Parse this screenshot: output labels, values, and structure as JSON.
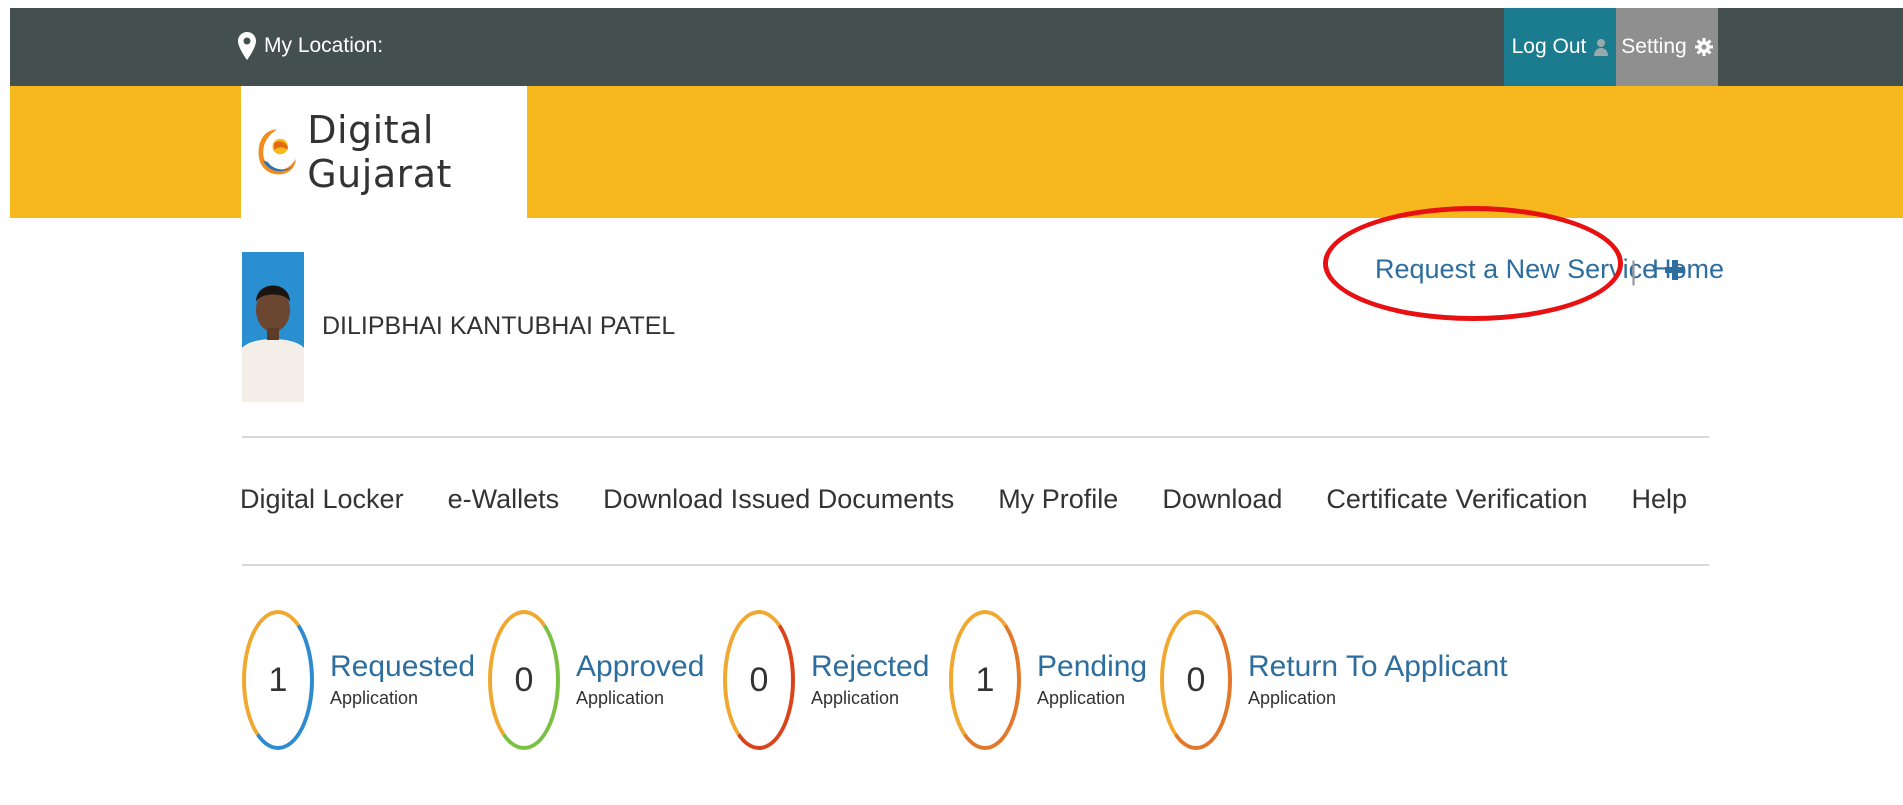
{
  "topbar": {
    "location_label": "My Location:",
    "logout_label": "Log Out",
    "setting_label": "Setting"
  },
  "brand": {
    "name": "Digital Gujarat"
  },
  "user": {
    "name": "DILIPBHAI KANTUBHAI PATEL"
  },
  "actions": {
    "request_label": "Request a New Service",
    "separator": "|",
    "home_label": "Home"
  },
  "nav": {
    "items": [
      "Digital Locker",
      "e-Wallets",
      "Download Issued Documents",
      "My Profile",
      "Download",
      "Certificate Verification",
      "Help"
    ]
  },
  "stats": [
    {
      "count": "1",
      "title": "Requested",
      "sub": "Application",
      "ring": "#2e8bd0"
    },
    {
      "count": "0",
      "title": "Approved",
      "sub": "Application",
      "ring": "#7ac143"
    },
    {
      "count": "0",
      "title": "Rejected",
      "sub": "Application",
      "ring": "#d9441d"
    },
    {
      "count": "1",
      "title": "Pending",
      "sub": "Application",
      "ring": "#e3782a"
    },
    {
      "count": "0",
      "title": "Return To Applicant",
      "sub": "Application",
      "ring": "#e3782a"
    }
  ],
  "colors": {
    "topbar": "#444f50",
    "banner": "#f6b81c",
    "logout_bg": "#1a7c8e",
    "setting_bg": "#8f8f8f",
    "link": "#2e6e9e",
    "highlight": "#e81111"
  }
}
